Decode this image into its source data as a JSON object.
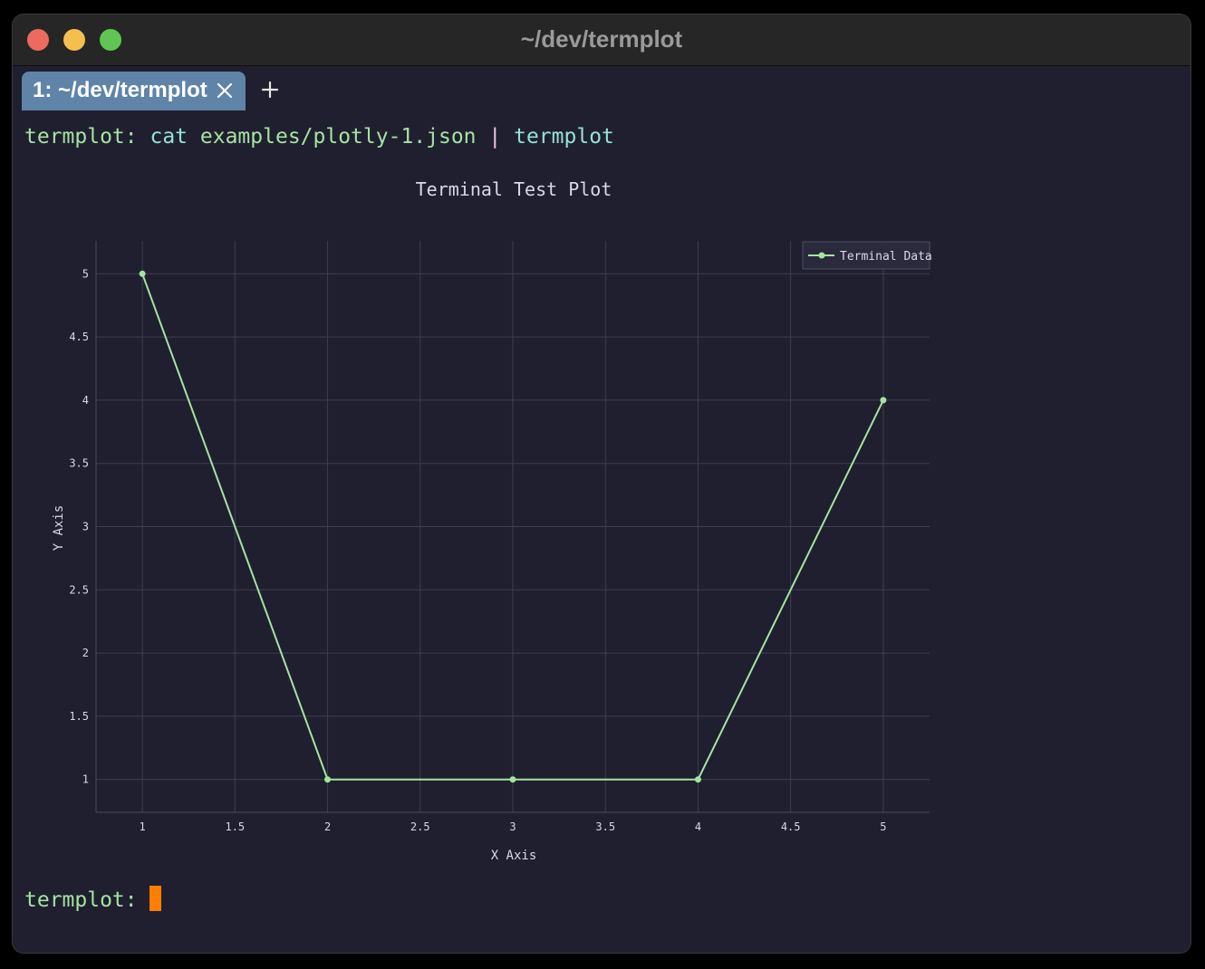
{
  "window": {
    "title": "~/dev/termplot"
  },
  "tabs": [
    {
      "label": "1: ~/dev/termplot"
    }
  ],
  "terminal": {
    "command": {
      "prompt": "termplot:",
      "cmd": "cat",
      "args": "examples/plotly-1.json",
      "pipe": "|",
      "cmd2": "termplot"
    },
    "prompt2": "termplot:"
  },
  "colors": {
    "background": "#1f1f2f",
    "line": "#a6e3a1",
    "cursor": "#fe7e00",
    "tab": "#5f84a8"
  },
  "icons": {
    "close": "close-icon",
    "add": "plus-icon"
  },
  "chart_data": {
    "type": "line",
    "title": "Terminal Test Plot",
    "xlabel": "X Axis",
    "ylabel": "Y Axis",
    "x": [
      1,
      2,
      3,
      4,
      5
    ],
    "series": [
      {
        "name": "Terminal Data",
        "values": [
          5,
          1,
          1,
          1,
          4
        ]
      }
    ],
    "xticks": [
      "1",
      "1.5",
      "2",
      "2.5",
      "3",
      "3.5",
      "4",
      "4.5",
      "5"
    ],
    "yticks": [
      "1",
      "1.5",
      "2",
      "2.5",
      "3",
      "3.5",
      "4",
      "4.5",
      "5"
    ],
    "xlim": [
      0.75,
      5.25
    ],
    "ylim": [
      0.74,
      5.26
    ],
    "grid": true,
    "legend": "top-right"
  }
}
